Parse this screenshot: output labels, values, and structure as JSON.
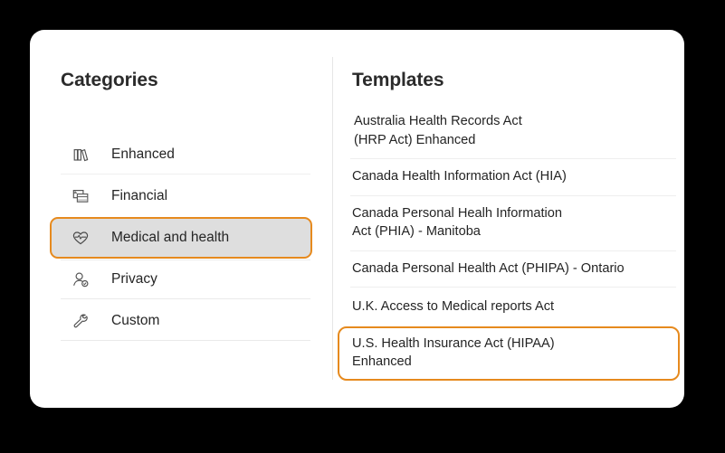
{
  "card": {
    "accent_color": "#e68a1e",
    "selected_fill": "#dedede",
    "background": "#ffffff",
    "page_background": "#000000"
  },
  "categories": {
    "heading": "Categories",
    "items": [
      {
        "label": "Enhanced",
        "icon": "books-icon",
        "selected": false
      },
      {
        "label": "Financial",
        "icon": "windows-card-icon",
        "selected": false
      },
      {
        "label": "Medical and health",
        "icon": "heart-pulse-icon",
        "selected": true
      },
      {
        "label": "Privacy",
        "icon": "person-badge-icon",
        "selected": false
      },
      {
        "label": "Custom",
        "icon": "wrench-icon",
        "selected": false
      }
    ]
  },
  "templates": {
    "heading": "Templates",
    "items": [
      {
        "label": "Australia Health Records Act\n(HRP Act) Enhanced",
        "selected": false
      },
      {
        "label": "Canada Health Information Act (HIA)",
        "selected": false
      },
      {
        "label": "Canada Personal Healh Information\nAct (PHIA) - Manitoba",
        "selected": false
      },
      {
        "label": "Canada Personal Health Act (PHIPA) - Ontario",
        "selected": false
      },
      {
        "label": "U.K. Access to Medical reports Act",
        "selected": false
      },
      {
        "label": "U.S. Health Insurance Act (HIPAA)\nEnhanced",
        "selected": true
      }
    ]
  }
}
